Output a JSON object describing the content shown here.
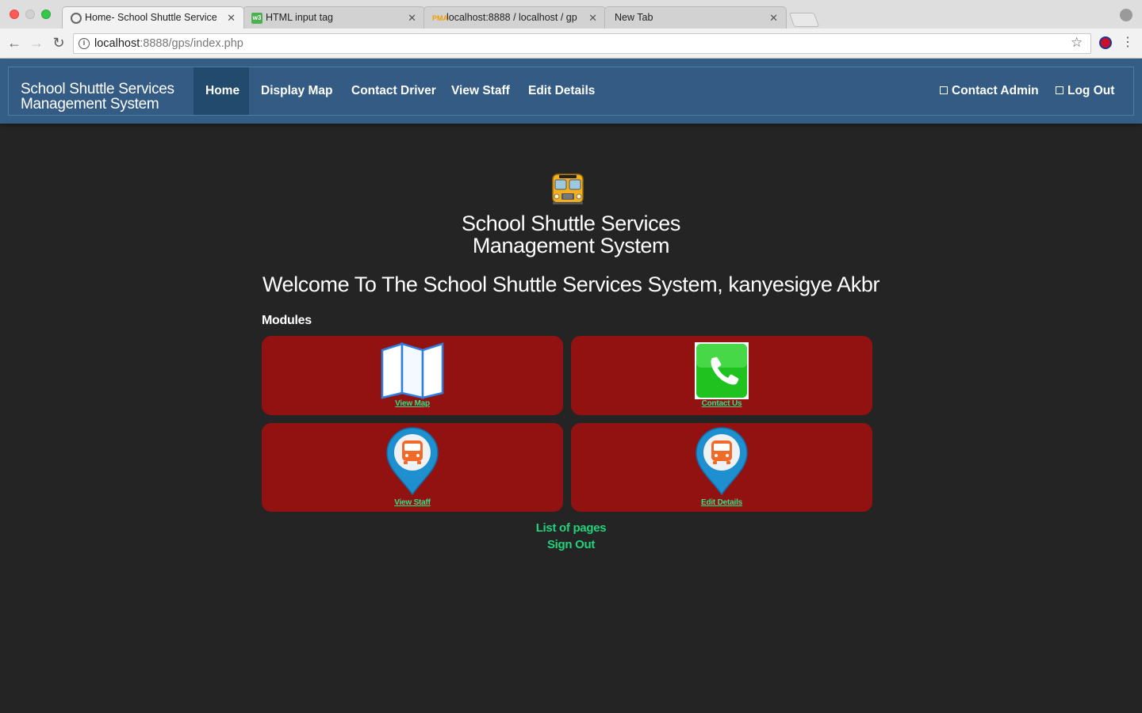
{
  "browser": {
    "tabs": [
      {
        "title": "Home- School Shuttle Service",
        "favicon": "globe-icon",
        "active": true
      },
      {
        "title": "HTML input tag",
        "favicon": "w3schools-icon",
        "active": false
      },
      {
        "title": "localhost:8888 / localhost / gp",
        "favicon": "phpmyadmin-icon",
        "active": false
      },
      {
        "title": "New Tab",
        "favicon": "",
        "active": false
      }
    ],
    "url_host": "localhost",
    "url_path": ":8888/gps/index.php",
    "pma_favicon_text": "PMA",
    "w3_favicon_text": "w3"
  },
  "navbar": {
    "brand": "School Shuttle Services Management System",
    "items": [
      {
        "label": "Home",
        "active": true
      },
      {
        "label": "Display Map"
      },
      {
        "label": "Contact Driver"
      },
      {
        "label": "View Staff"
      },
      {
        "label": "Edit Details"
      }
    ],
    "right": [
      {
        "label": "Contact Admin",
        "icon": "square-icon"
      },
      {
        "label": "Log Out",
        "icon": "square-icon"
      }
    ],
    "colors": {
      "bar": "#345e86",
      "active": "#224a6d"
    }
  },
  "main": {
    "title_line1": "School Shuttle Services",
    "title_line2": "Management System",
    "welcome": "Welcome To The School Shuttle Services System, kanyesigye Akbr",
    "modules_label": "Modules",
    "modules": [
      {
        "label": "View Map",
        "icon": "folded-map-icon"
      },
      {
        "label": "Contact Us",
        "icon": "phone-icon"
      },
      {
        "label": "View Staff",
        "icon": "bus-location-pin-icon"
      },
      {
        "label": "Edit Details",
        "icon": "bus-location-pin-icon"
      }
    ],
    "footer_links": [
      "List of pages",
      "Sign Out"
    ],
    "colors": {
      "background": "#242424",
      "module_bg": "#921111",
      "link": "#22d27c"
    }
  }
}
